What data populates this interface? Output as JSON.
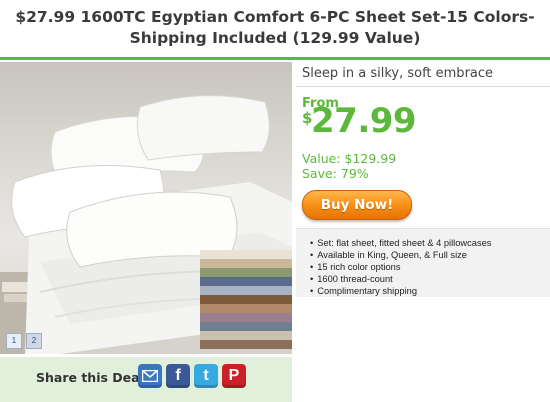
{
  "title": "$27.99 1600TC Egyptian Comfort 6-PC Sheet Set-15 Colors-Shipping Included (129.99 Value)",
  "gallery": {
    "pages": [
      "1",
      "2"
    ],
    "active_page": 1
  },
  "share": {
    "label": "Share this Deal",
    "icons": [
      "email-icon",
      "facebook-icon",
      "twitter-icon",
      "pinterest-icon"
    ]
  },
  "offer": {
    "tagline": "Sleep in a silky, soft embrace",
    "from_label": "From",
    "currency": "$",
    "price": "27.99",
    "value": "Value: $129.99",
    "save": "Save: 79%",
    "buy_label": "Buy Now!"
  },
  "features": [
    "Set: flat sheet, fitted sheet & 4 pillowcases",
    "Available in King, Queen, & Full size",
    "15 rich color options",
    "1600 thread-count",
    "Complimentary shipping"
  ],
  "colors": {
    "accent": "#5cb83a",
    "button": "#f78d13",
    "share_bg": "#e1f0da"
  }
}
